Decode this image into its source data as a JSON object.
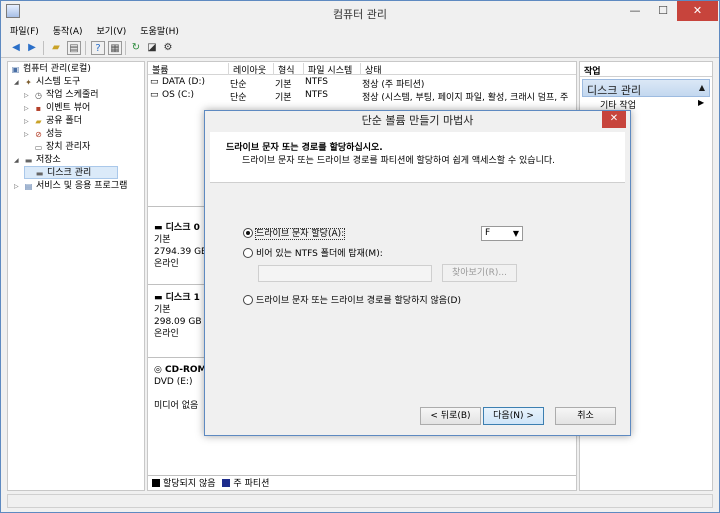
{
  "window": {
    "title": "컴퓨터 관리",
    "minimize": "—",
    "maximize": "☐",
    "close": "✕"
  },
  "menu": [
    "파일(F)",
    "동작(A)",
    "보기(V)",
    "도움말(H)"
  ],
  "tree": {
    "root": "컴퓨터 관리(로컬)",
    "system_tools": "시스템 도구",
    "task_scheduler": "작업 스케줄러",
    "event_viewer": "이벤트 뷰어",
    "shared_folders": "공유 폴더",
    "performance": "성능",
    "device_manager": "장치 관리자",
    "storage": "저장소",
    "disk_management": "디스크 관리",
    "services_apps": "서비스 및 응용 프로그램"
  },
  "volumes": {
    "columns": [
      "볼륨",
      "레이아웃",
      "형식",
      "파일 시스템",
      "상태"
    ],
    "rows": [
      [
        "DATA (D:)",
        "단순",
        "기본",
        "NTFS",
        "정상 (주 파티션)"
      ],
      [
        "OS (C:)",
        "단순",
        "기본",
        "NTFS",
        "정상 (시스템, 부팅, 페이지 파일, 활성, 크래시 덤프, 주"
      ]
    ]
  },
  "disks": [
    {
      "name": "디스크 0",
      "type": "기본",
      "size": "2794.39 GB",
      "status": "온라인"
    },
    {
      "name": "디스크 1",
      "type": "기본",
      "size": "298.09 GB",
      "status": "온라인"
    },
    {
      "name": "CD-ROM",
      "type": "DVD (E:)",
      "size": "",
      "status": "미디어 없음"
    }
  ],
  "legend": {
    "unallocated": "할당되지 않음",
    "primary": "주 파티션"
  },
  "actions": {
    "header": "작업",
    "selected": "디스크 관리",
    "item": "기타 작업"
  },
  "dialog": {
    "title": "단순 볼륨 만들기 마법사",
    "close": "✕",
    "heading": "드라이브 문자 또는 경로를 할당하십시오.",
    "subheading": "드라이브 문자 또는 드라이브 경로를 파티션에 할당하여 쉽게 액세스할 수 있습니다.",
    "opt_assign": "드라이브 문자 할당(A):",
    "opt_mount": "비어 있는 NTFS 폴더에 탑재(M):",
    "opt_none": "드라이브 문자 또는 드라이브 경로를 할당하지 않음(D)",
    "drive_letter": "F",
    "browse": "찾아보기(R)...",
    "back": "< 뒤로(B)",
    "next": "다음(N) >",
    "cancel": "취소",
    "selected_option": "assign"
  },
  "colors": {
    "accent": "#5e8ac1",
    "close": "#c7443c",
    "selection": "#dbeaf9",
    "legend_unallocated": "#000000",
    "legend_primary": "#1d2c8c"
  }
}
